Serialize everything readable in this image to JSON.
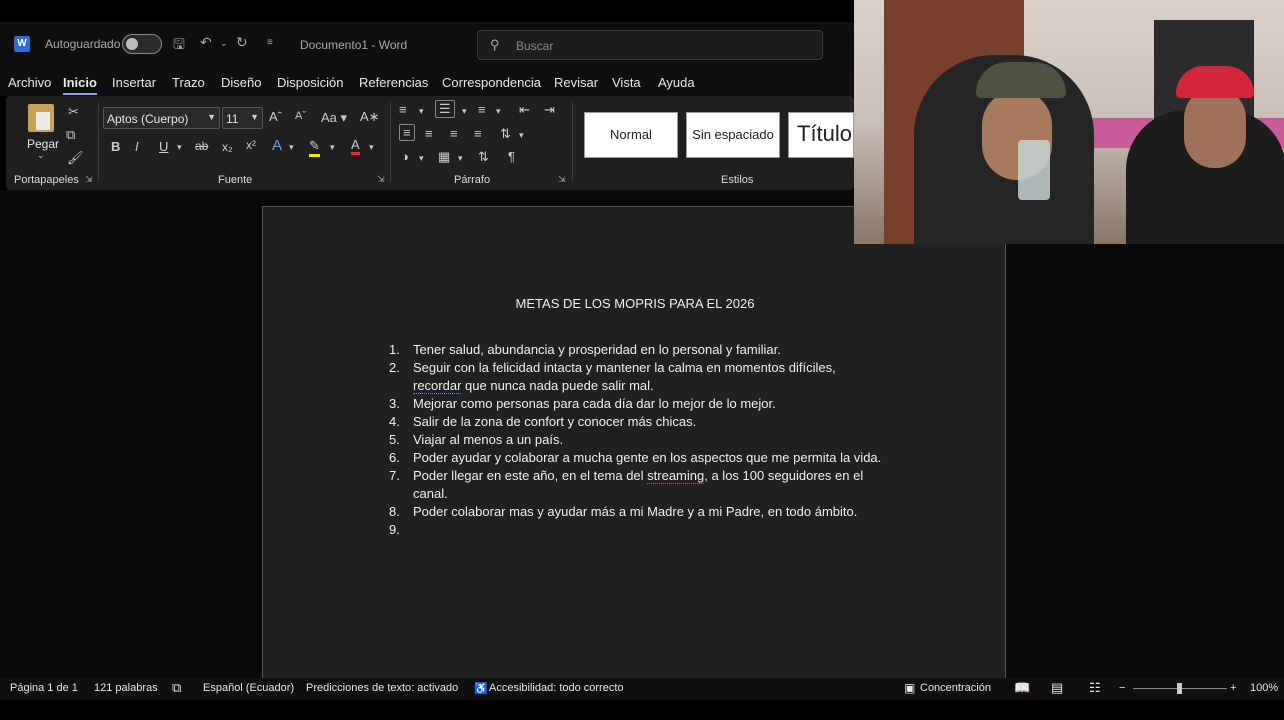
{
  "titlebar": {
    "autosave_label": "Autoguardado",
    "doc_title": "Documento1  -  Word",
    "search_placeholder": "Buscar"
  },
  "menu": [
    "Archivo",
    "Inicio",
    "Insertar",
    "Trazo",
    "Diseño",
    "Disposición",
    "Referencias",
    "Correspondencia",
    "Revisar",
    "Vista",
    "Ayuda"
  ],
  "ribbon": {
    "paste_label": "Pegar",
    "group_clipboard": "Portapapeles",
    "group_font": "Fuente",
    "group_paragraph": "Párrafo",
    "group_styles": "Estilos",
    "font_name": "Aptos (Cuerpo)",
    "font_size": "11",
    "case_label": "Aa",
    "styles": [
      "Normal",
      "Sin espaciado",
      "Título"
    ]
  },
  "document": {
    "heading": "METAS DE LOS MOPRIS PARA EL 2026",
    "items": [
      {
        "num": "1.",
        "text": "Tener salud, abundancia y prosperidad en lo personal y familiar."
      },
      {
        "num": "2.",
        "text_a": "Seguir con la felicidad intacta y mantener la calma en momentos difíciles,",
        "text_b_flag": "recordar",
        "text_b_rest": " que nunca nada puede salir mal."
      },
      {
        "num": "3.",
        "text": "Mejorar como personas para cada día dar lo mejor de lo mejor."
      },
      {
        "num": "4.",
        "text": "Salir de la zona de confort y conocer más chicas."
      },
      {
        "num": "5.",
        "text": "Viajar al menos a un país."
      },
      {
        "num": "6.",
        "text": "Poder ayudar y colaborar a mucha gente en los aspectos que me permita la vida."
      },
      {
        "num": "7.",
        "text_a": "Poder llegar en este año, en el tema del ",
        "text_flag": "streaming",
        "text_b": ", a los 100 seguidores en el canal."
      },
      {
        "num": "8.",
        "text": "Poder colaborar mas y ayudar más a mi Madre y a mi Padre, en todo ámbito."
      },
      {
        "num": "9.",
        "text": ""
      }
    ]
  },
  "status": {
    "page": "Página 1 de 1",
    "words": "121 palabras",
    "language": "Español (Ecuador)",
    "predictions": "Predicciones de texto: activado",
    "accessibility": "Accesibilidad: todo correcto",
    "focus": "Concentración",
    "zoom": "100%"
  }
}
